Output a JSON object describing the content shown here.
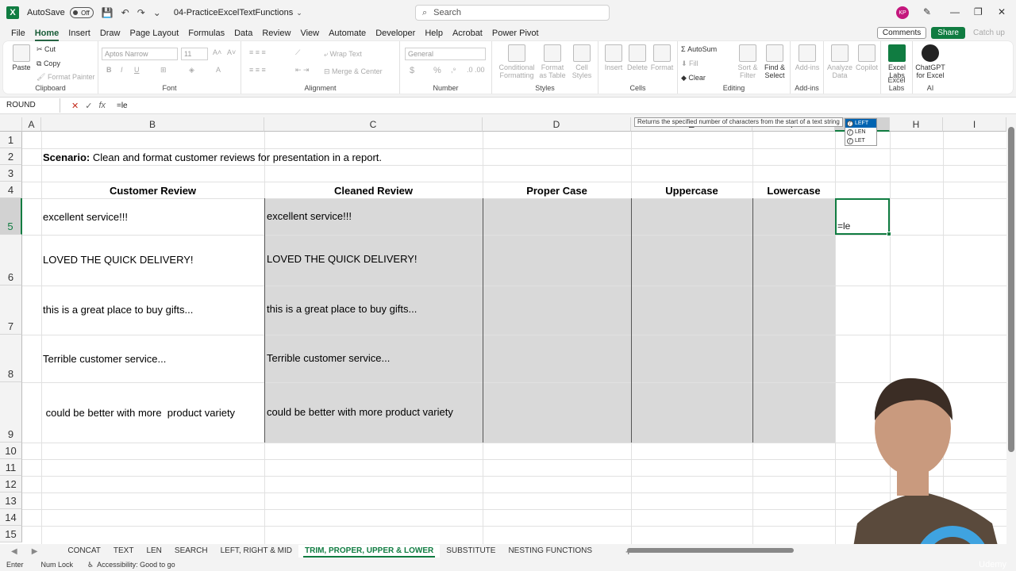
{
  "titlebar": {
    "autosave_label": "AutoSave",
    "autosave_state": "Off",
    "filename": "04-PracticeExcelTextFunctions",
    "search_placeholder": "Search",
    "avatar_initials": "KP"
  },
  "menu": {
    "tabs": [
      "File",
      "Home",
      "Insert",
      "Draw",
      "Page Layout",
      "Formulas",
      "Data",
      "Review",
      "View",
      "Automate",
      "Developer",
      "Help",
      "Acrobat",
      "Power Pivot"
    ],
    "active": "Home",
    "comments": "Comments",
    "share": "Share",
    "catchup": "Catch up"
  },
  "ribbon": {
    "clipboard": {
      "label": "Clipboard",
      "paste": "Paste",
      "cut": "Cut",
      "copy": "Copy",
      "format_painter": "Format Painter"
    },
    "font": {
      "label": "Font",
      "font_name": "Aptos Narrow",
      "font_size": "11"
    },
    "alignment": {
      "label": "Alignment",
      "wrap": "Wrap Text",
      "merge": "Merge & Center"
    },
    "number": {
      "label": "Number",
      "format": "General"
    },
    "styles": {
      "label": "Styles",
      "conditional": "Conditional Formatting",
      "format_table": "Format as Table",
      "cell_styles": "Cell Styles"
    },
    "cells": {
      "label": "Cells",
      "insert": "Insert",
      "delete": "Delete",
      "format": "Format"
    },
    "editing": {
      "label": "Editing",
      "autosum": "AutoSum",
      "fill": "Fill",
      "clear": "Clear",
      "sort": "Sort & Filter",
      "find": "Find & Select"
    },
    "addins": {
      "label": "Add-ins",
      "addins_btn": "Add-ins",
      "analyze": "Analyze Data",
      "copilot": "Copilot"
    },
    "excellabs": {
      "label": "Excel Labs",
      "btn": "Excel Labs"
    },
    "ai": {
      "label": "AI",
      "btn": "ChatGPT for Excel"
    }
  },
  "formula_bar": {
    "name_box": "ROUND",
    "formula": "=le"
  },
  "grid": {
    "columns": [
      "A",
      "B",
      "C",
      "D",
      "E",
      "F",
      "G",
      "H",
      "I"
    ],
    "rows": [
      "1",
      "2",
      "3",
      "4",
      "5",
      "6",
      "7",
      "8",
      "9",
      "10",
      "11",
      "12",
      "13",
      "14",
      "15"
    ],
    "scenario_bold": "Scenario:",
    "scenario_text": " Clean and format customer reviews for presentation in a report.",
    "headers": {
      "customer_review": "Customer Review",
      "cleaned_review": "Cleaned Review",
      "proper_case": "Proper Case",
      "uppercase": "Uppercase",
      "lowercase": "Lowercase"
    },
    "customer_reviews": [
      "excellent  service!!!",
      "LOVED THE QUICK DELIVERY!",
      "this is a great place to buy gifts...",
      "Terrible customer service...",
      " could be better with more  product variety"
    ],
    "cleaned_reviews": [
      "excellent service!!!",
      "LOVED THE QUICK DELIVERY!",
      "this is a great place to buy gifts...",
      "Terrible customer service...",
      "could be better with more product variety"
    ],
    "editing_value": "=le",
    "tooltip": "Returns the specified number of characters from the start of a text string",
    "autocomplete": [
      "LEFT",
      "LEN",
      "LET"
    ]
  },
  "sheets": {
    "tabs": [
      "CONCAT",
      "TEXT",
      "LEN",
      "SEARCH",
      "LEFT, RIGHT & MID",
      "TRIM, PROPER, UPPER & LOWER",
      "SUBSTITUTE",
      "NESTING FUNCTIONS"
    ],
    "active": "TRIM, PROPER, UPPER & LOWER"
  },
  "status": {
    "mode": "Enter",
    "numlock": "Num Lock",
    "accessibility": "Accessibility: Good to go",
    "watermark": "Udemy"
  },
  "colors": {
    "accent": "#107c41",
    "shade": "#d9d9d9",
    "selection": "#0063b1"
  }
}
